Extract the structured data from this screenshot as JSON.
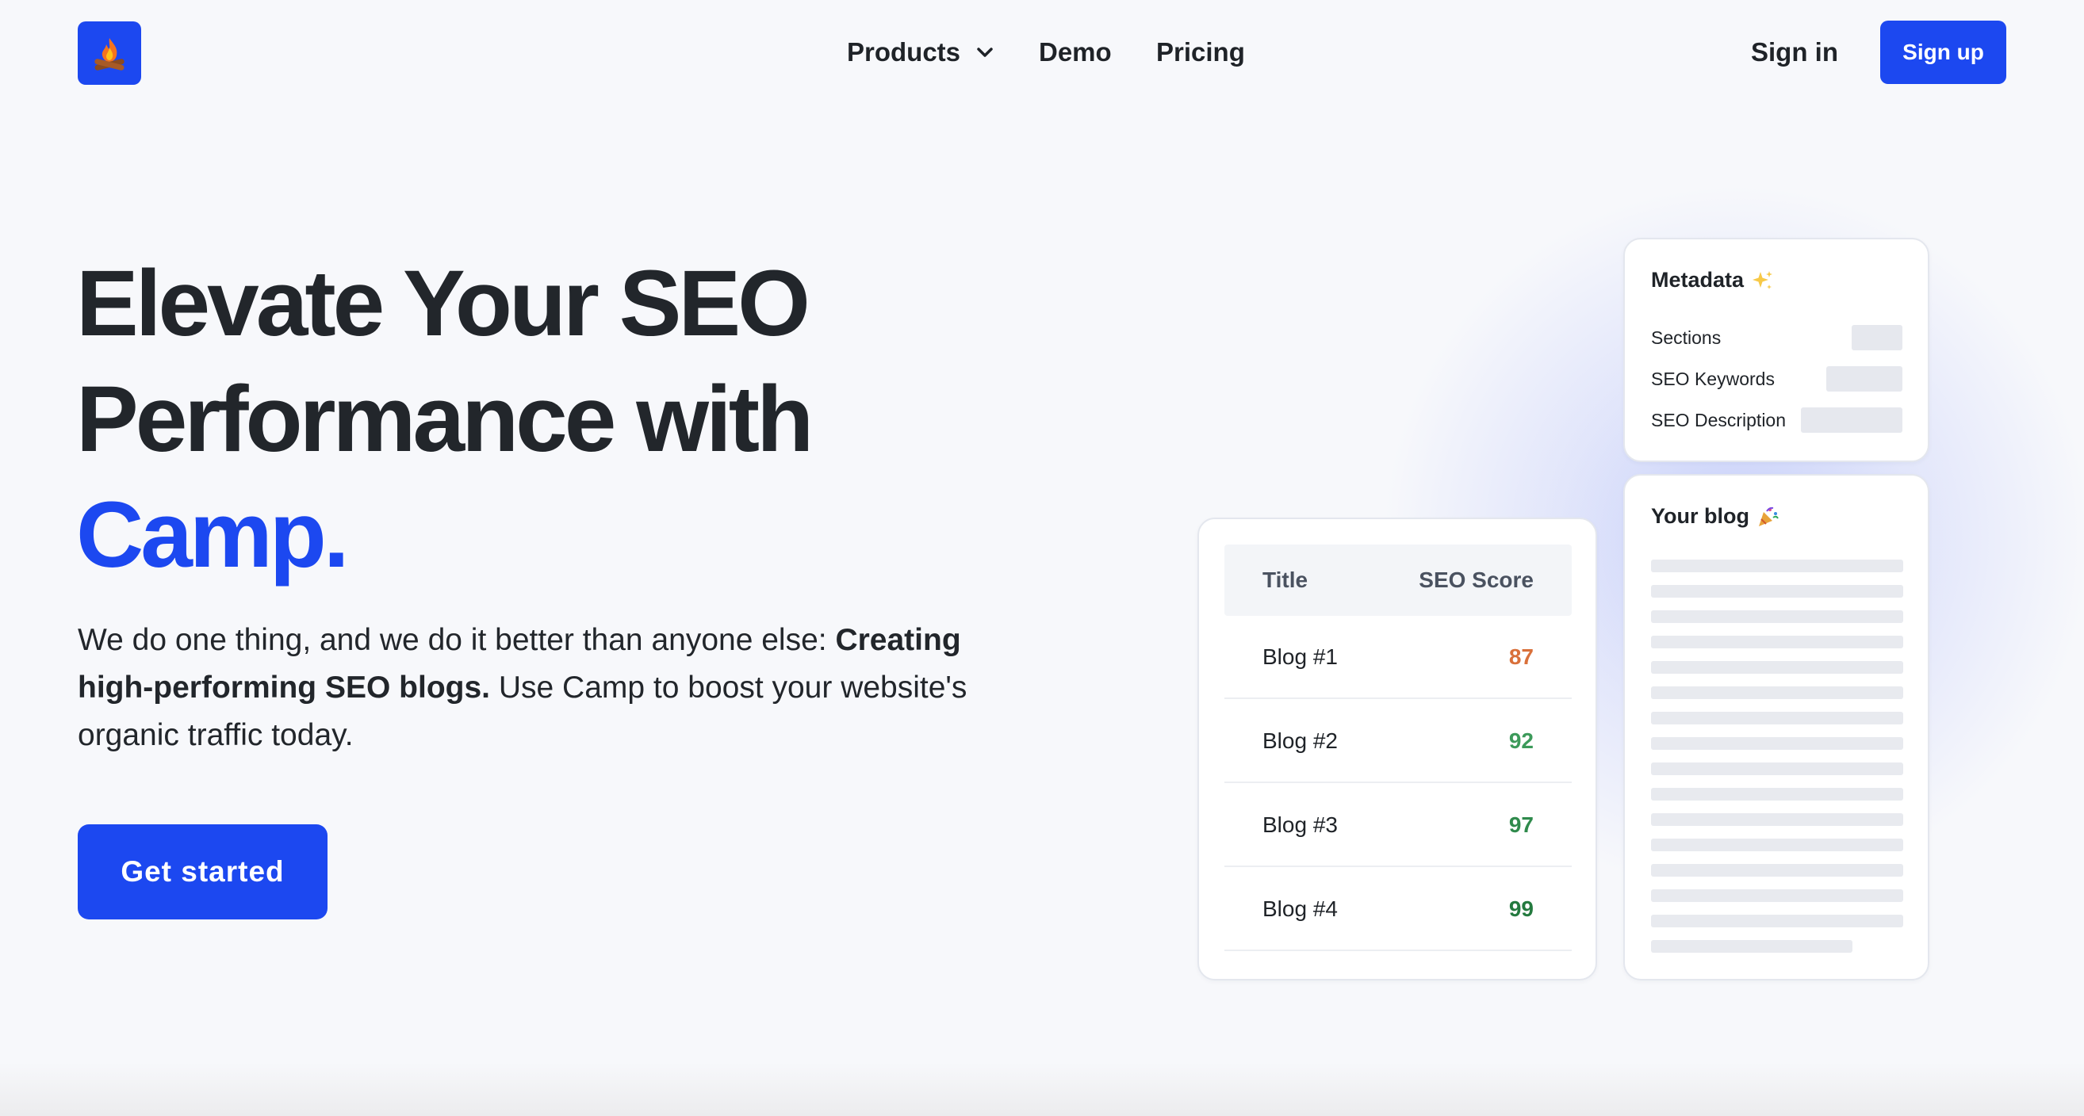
{
  "header": {
    "logo_icon": "campfire-icon",
    "nav": [
      {
        "label": "Products",
        "has_dropdown": true
      },
      {
        "label": "Demo"
      },
      {
        "label": "Pricing"
      }
    ],
    "sign_in": "Sign in",
    "sign_up": "Sign up"
  },
  "hero": {
    "title_line1": "Elevate Your SEO",
    "title_line2": "Performance with",
    "title_accent": "Camp.",
    "sub_plain1": "We do one thing, and we do it better than anyone else: ",
    "sub_bold": "Creating high-performing SEO blogs.",
    "sub_plain2": " Use Camp to boost your website's organic traffic today.",
    "cta": "Get started"
  },
  "table_card": {
    "col_title": "Title",
    "col_score": "SEO Score",
    "rows": [
      {
        "title": "Blog #1",
        "score": "87",
        "color": "#d9703a"
      },
      {
        "title": "Blog #2",
        "score": "92",
        "color": "#3c9a5a"
      },
      {
        "title": "Blog #3",
        "score": "97",
        "color": "#2f8a4c"
      },
      {
        "title": "Blog #4",
        "score": "99",
        "color": "#247a3f"
      }
    ]
  },
  "metadata_card": {
    "title": "Metadata",
    "title_icon": "sparkles-icon",
    "rows": [
      "Sections",
      "SEO Keywords",
      "SEO Description"
    ]
  },
  "blog_card": {
    "title": "Your blog",
    "title_icon": "party-popper-icon"
  },
  "colors": {
    "brand": "#1c48f0",
    "text": "#1f2328",
    "background": "#f7f8fb"
  }
}
